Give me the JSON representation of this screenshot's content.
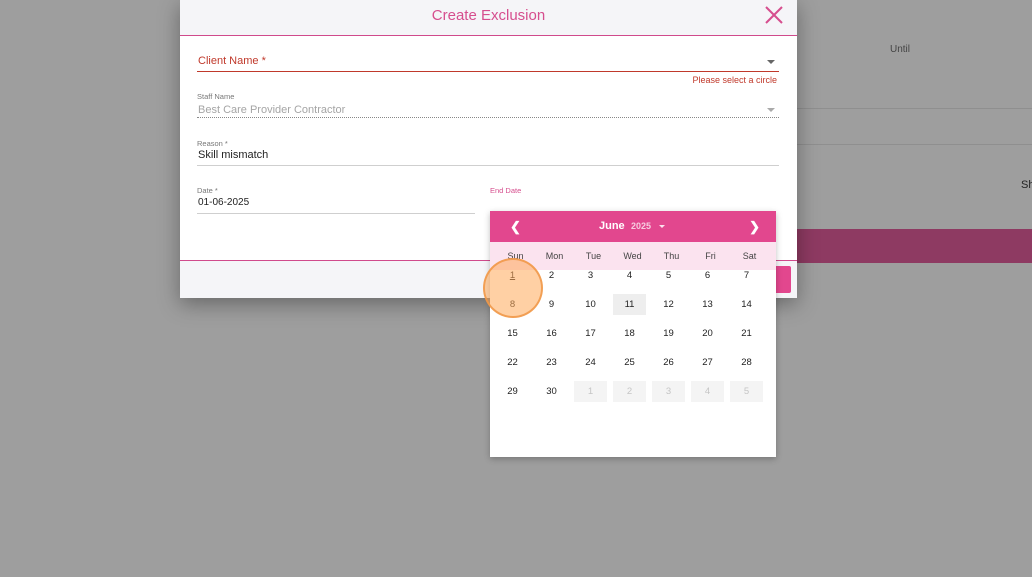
{
  "background": {
    "until_label": "Until",
    "side_text": "Sh"
  },
  "dialog": {
    "title": "Create Exclusion",
    "client_name_label": "Client Name *",
    "client_error": "Please select a circle",
    "staff_name_label": "Staff Name",
    "staff_name_value": "Best Care Provider Contractor",
    "reason_label": "Reason *",
    "reason_value": "Skill mismatch",
    "date_label": "Date *",
    "date_value": "01-06-2025",
    "end_date_label": "End Date"
  },
  "calendar": {
    "prev": "❮",
    "next": "❯",
    "month": "June",
    "year": "2025",
    "weekdays": [
      "Sun",
      "Mon",
      "Tue",
      "Wed",
      "Thu",
      "Fri",
      "Sat"
    ],
    "weeks": [
      [
        "1",
        "2",
        "3",
        "4",
        "5",
        "6",
        "7"
      ],
      [
        "8",
        "9",
        "10",
        "11",
        "12",
        "13",
        "14"
      ],
      [
        "15",
        "16",
        "17",
        "18",
        "19",
        "20",
        "21"
      ],
      [
        "22",
        "23",
        "24",
        "25",
        "26",
        "27",
        "28"
      ],
      [
        "29",
        "30",
        "1",
        "2",
        "3",
        "4",
        "5"
      ]
    ],
    "selected_day": "1",
    "highlighted_day": "11"
  },
  "colors": {
    "accent": "#e2478e",
    "error": "#c0392b"
  }
}
